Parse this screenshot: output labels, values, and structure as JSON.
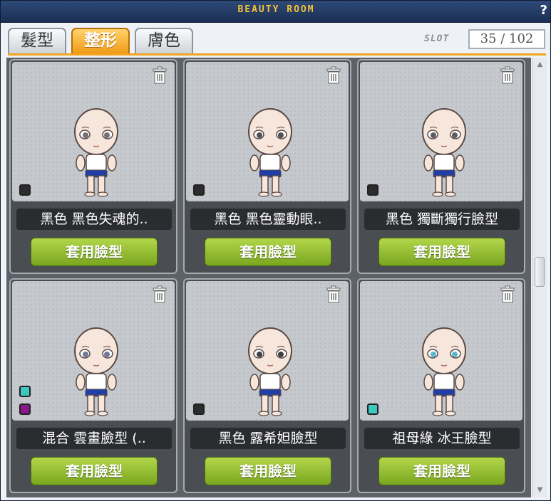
{
  "window": {
    "title": "BEAUTY ROOM",
    "help_glyph": "?"
  },
  "tabs": [
    {
      "label": "髮型",
      "active": false
    },
    {
      "label": "整形",
      "active": true
    },
    {
      "label": "膚色",
      "active": false
    }
  ],
  "slot": {
    "label": "SLOT",
    "value": "35 / 102"
  },
  "cards": [
    {
      "name": "黑色  黑色失魂的..",
      "button": "套用臉型",
      "swatches": [
        "#2d2d2d"
      ],
      "eye_color": "#6f7177"
    },
    {
      "name": "黑色  黑色靈動眼..",
      "button": "套用臉型",
      "swatches": [
        "#2d2d2d"
      ],
      "eye_color": "#4e5053"
    },
    {
      "name": "黑色  獨斷獨行臉型",
      "button": "套用臉型",
      "swatches": [
        "#2d2d2d"
      ],
      "eye_color": "#5a5c60"
    },
    {
      "name": "混合  雲畫臉型 (..",
      "button": "套用臉型",
      "swatches": [
        "#3cc8c0",
        "#8b168e"
      ],
      "eye_color": "#6f7899"
    },
    {
      "name": "黑色  露希妲臉型",
      "button": "套用臉型",
      "swatches": [
        "#2d2d2d"
      ],
      "eye_color": "#3f4044"
    },
    {
      "name": "祖母綠  冰王臉型",
      "button": "套用臉型",
      "swatches": [
        "#3cc8c0"
      ],
      "eye_color": "#59b7cf"
    }
  ],
  "icons": {
    "trash": "trash-icon",
    "scroll_up": "chevron-up-icon",
    "scroll_down": "chevron-down-icon"
  }
}
